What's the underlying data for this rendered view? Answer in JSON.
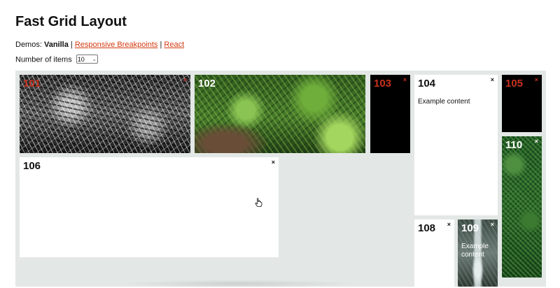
{
  "page": {
    "title": "Fast Grid Layout"
  },
  "demos": {
    "label": "Demos:",
    "current": "Vanilla",
    "separator": "|",
    "links": [
      "Responsive Breakpoints",
      "React"
    ]
  },
  "items_control": {
    "label": "Number of items",
    "selected": "10"
  },
  "tiles": [
    {
      "id": "101",
      "close": "×"
    },
    {
      "id": "102"
    },
    {
      "id": "103",
      "close": "×"
    },
    {
      "id": "104",
      "close": "×",
      "content": "Example content"
    },
    {
      "id": "105",
      "close": "×"
    },
    {
      "id": "106",
      "close": "×"
    },
    {
      "id": "108",
      "close": "×"
    },
    {
      "id": "109",
      "close": "×",
      "content": "Example content"
    },
    {
      "id": "110",
      "close": "×"
    }
  ],
  "colors": {
    "link": "#d43b12",
    "grid_background": "#e3e8e6",
    "black_tile_number": "#c8321f"
  },
  "icons": {
    "cursor": "pointer-hand-icon",
    "close": "close-icon",
    "dropdown": "chevron-down-icon"
  }
}
